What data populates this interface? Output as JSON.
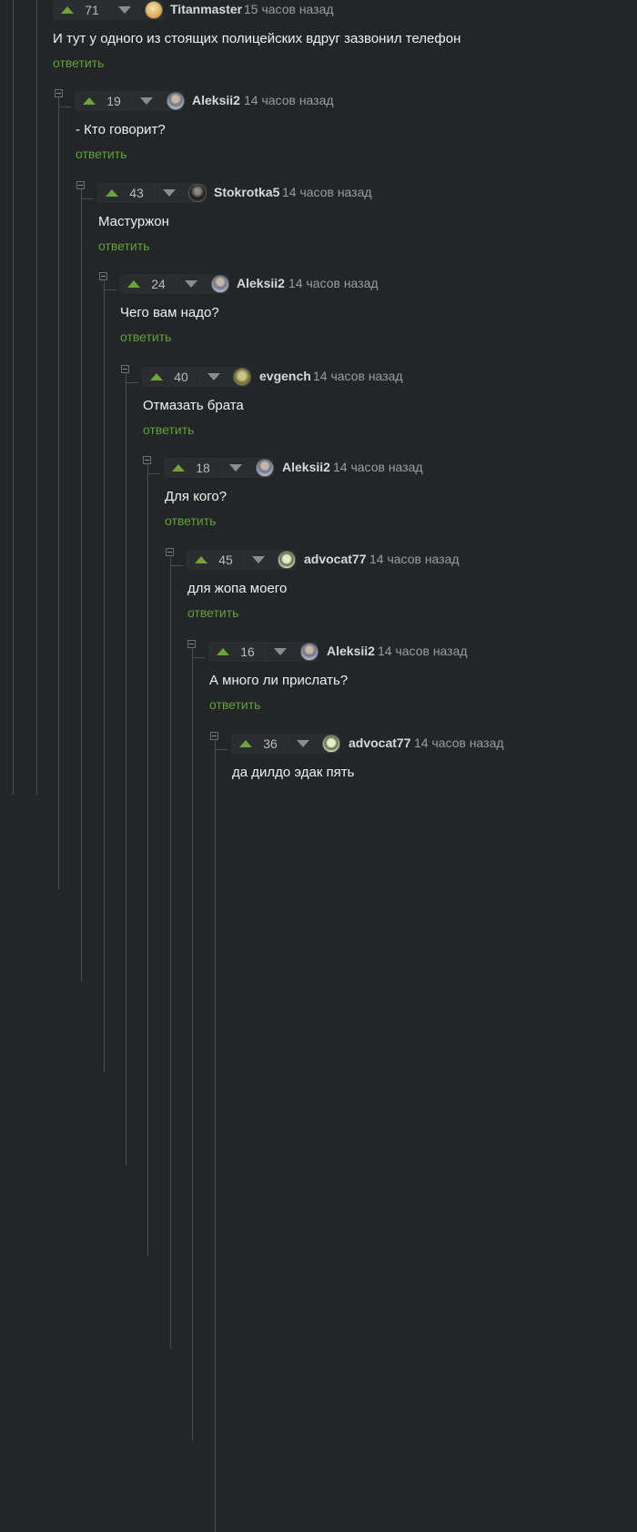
{
  "reply_label": "ответить",
  "comments": [
    {
      "votes": "71",
      "author": "Titanmaster",
      "time": "15 часов назад",
      "text": "И тут у одного из стоящих полицейских вдруг зазвонил телефон",
      "avatar": "gold-avatar"
    },
    {
      "votes": "19",
      "author": "Aleksii2",
      "time": "14 часов назад",
      "text": "- Кто говорит?",
      "avatar": "photo-avatar"
    },
    {
      "votes": "43",
      "author": "Stokrotka5",
      "time": "14 часов назад",
      "text": "Мастуржон",
      "avatar": "dark-avatar"
    },
    {
      "votes": "24",
      "author": "Aleksii2",
      "time": "14 часов назад",
      "text": "Чего вам надо?",
      "avatar": "photo-avatar"
    },
    {
      "votes": "40",
      "author": "evgench",
      "time": "14 часов назад",
      "text": "Отмазать брата",
      "avatar": "olive-avatar"
    },
    {
      "votes": "18",
      "author": "Aleksii2",
      "time": "14 часов назад",
      "text": "Для кого?",
      "avatar": "photo-avatar"
    },
    {
      "votes": "45",
      "author": "advocat77",
      "time": "14 часов назад",
      "text": "для жопа моего",
      "avatar": "tree-avatar"
    },
    {
      "votes": "16",
      "author": "Aleksii2",
      "time": "14 часов назад",
      "text": "А много ли прислать?",
      "avatar": "photo-avatar"
    },
    {
      "votes": "36",
      "author": "advocat77",
      "time": "14 часов назад",
      "text": "да дилдо эдак пять",
      "avatar": "tree-avatar"
    }
  ],
  "colors": {
    "background": "#232527",
    "upvote": "#6fa23a",
    "reply": "#5fa238",
    "thread_line": "#4a4c4f"
  }
}
